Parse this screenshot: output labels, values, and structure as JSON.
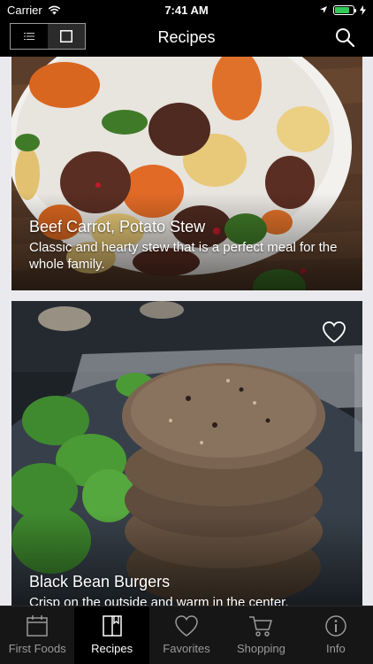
{
  "status_bar": {
    "carrier": "Carrier",
    "time": "7:41 AM",
    "battery_level": 0.8
  },
  "nav": {
    "title": "Recipes",
    "view_toggle": [
      "list-view-icon",
      "grid-view-icon"
    ],
    "search_icon": "search-icon"
  },
  "recipes": [
    {
      "title": "Beef Carrot, Potato Stew",
      "description": "Classic and hearty stew that is a perfect meal for the whole family.",
      "image": "beef-stew-photo"
    },
    {
      "title": "Black Bean Burgers",
      "description": "Crisp on the outside and warm in the center,",
      "image": "black-bean-burgers-photo",
      "favorite_icon": "heart-icon"
    }
  ],
  "tabs": [
    {
      "label": "First Foods",
      "icon": "calendar-icon",
      "active": false
    },
    {
      "label": "Recipes",
      "icon": "book-icon",
      "active": true
    },
    {
      "label": "Favorites",
      "icon": "heart-icon",
      "active": false
    },
    {
      "label": "Shopping",
      "icon": "cart-icon",
      "active": false
    },
    {
      "label": "Info",
      "icon": "info-icon",
      "active": false
    }
  ],
  "colors": {
    "bar_background": "#000000",
    "tab_background": "#161616",
    "tab_inactive": "#9a9a9a",
    "battery": "#34c759"
  }
}
